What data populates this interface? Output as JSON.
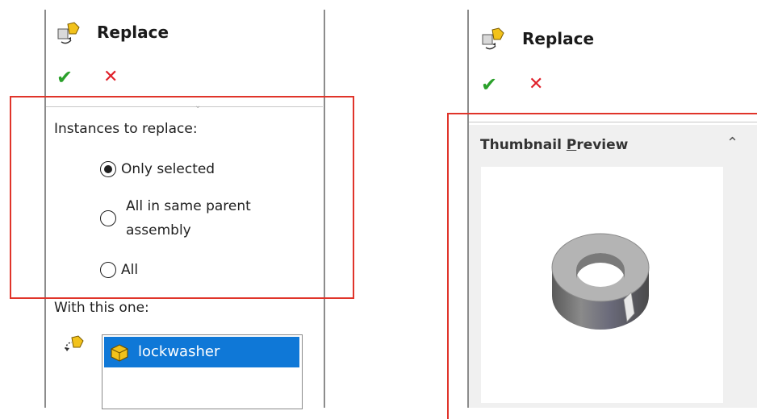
{
  "left_panel": {
    "title": "Replace",
    "instances_label": "Instances to replace:",
    "options": [
      {
        "label": "Only selected",
        "checked": true
      },
      {
        "label_line1": "All in same parent",
        "label_line2": "assembly",
        "checked": false
      },
      {
        "label": "All",
        "checked": false
      }
    ],
    "with_label": "With this one:",
    "list_items": [
      "lockwasher"
    ]
  },
  "right_panel": {
    "title": "Replace",
    "section_title_pre": "Thumbnail ",
    "section_title_mnemonic": "P",
    "section_title_post": "review"
  },
  "colors": {
    "highlight_box": "#e0342a",
    "selection": "#0f78d7",
    "ok": "#2aa02a",
    "cancel": "#e0202a"
  },
  "icons": {
    "title_icon": "replace-components-icon",
    "ok": "checkmark-icon",
    "cancel": "close-icon",
    "part": "part-icon",
    "expand": "chevron-up-icon"
  }
}
